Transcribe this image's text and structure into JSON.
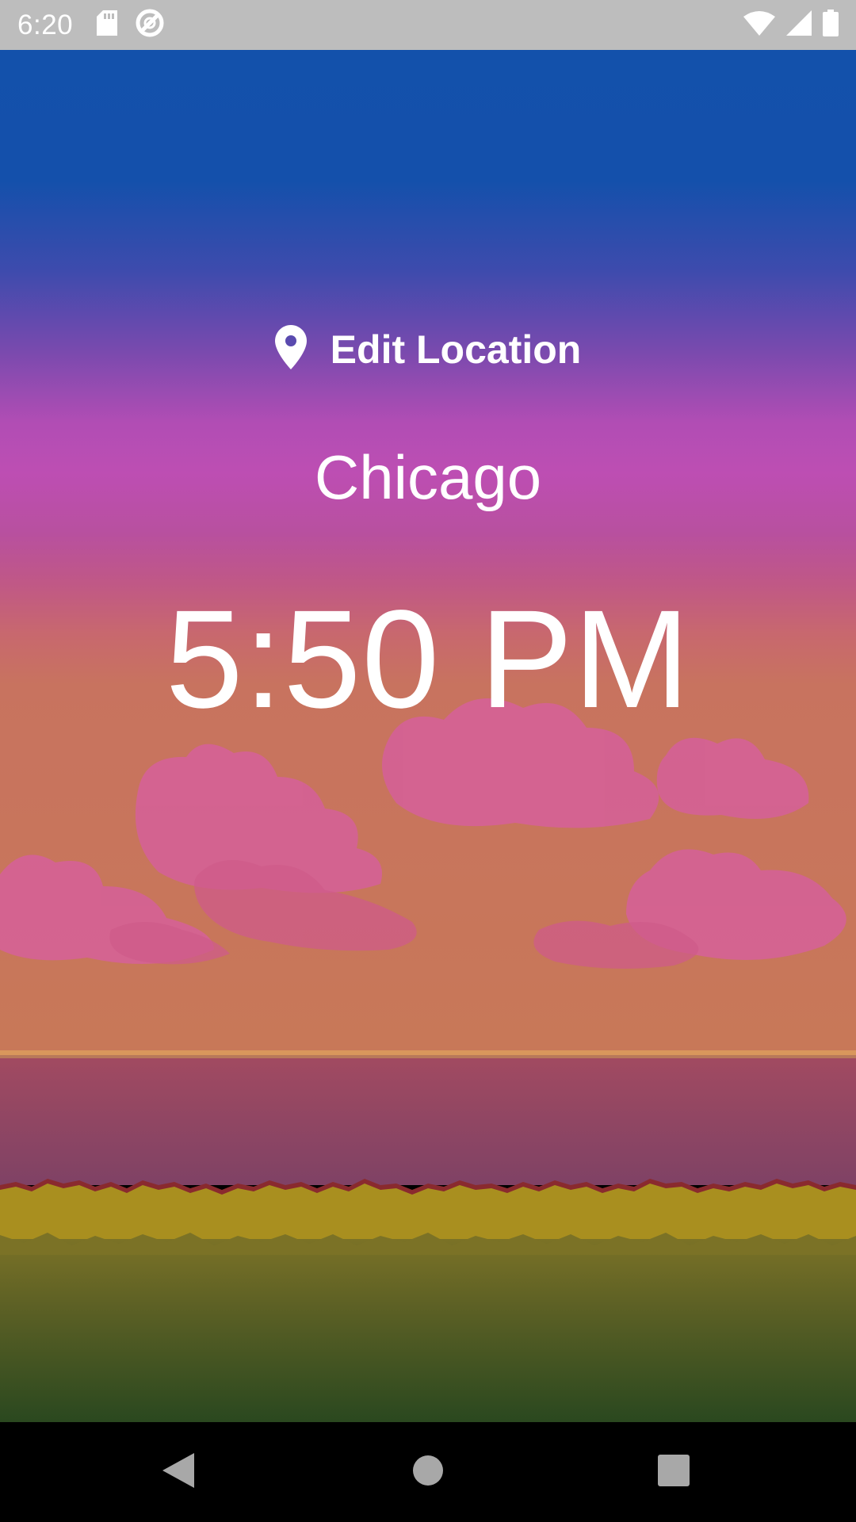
{
  "status_bar": {
    "time": "6:20",
    "icons_left": [
      "sd-card-icon",
      "data-saver-icon"
    ],
    "icons_right": [
      "wifi-icon",
      "cell-signal-icon",
      "battery-icon"
    ]
  },
  "location": {
    "edit_label": "Edit Location",
    "icon": "location-pin-icon"
  },
  "city": "Chicago",
  "local_time": "5:50 PM",
  "navigation": {
    "icons": [
      "back-icon",
      "home-icon",
      "recents-icon"
    ]
  },
  "colors": {
    "status_bar": "#bdbdbd",
    "sky_top": "#1351ab",
    "sky_purple": "#bc4db3",
    "horizon": "#c67558",
    "water": "#8e4663",
    "grass_light": "#a98f1f",
    "grass_dark": "#2c4820",
    "text": "#ffffff",
    "nav_bar": "#000000"
  }
}
